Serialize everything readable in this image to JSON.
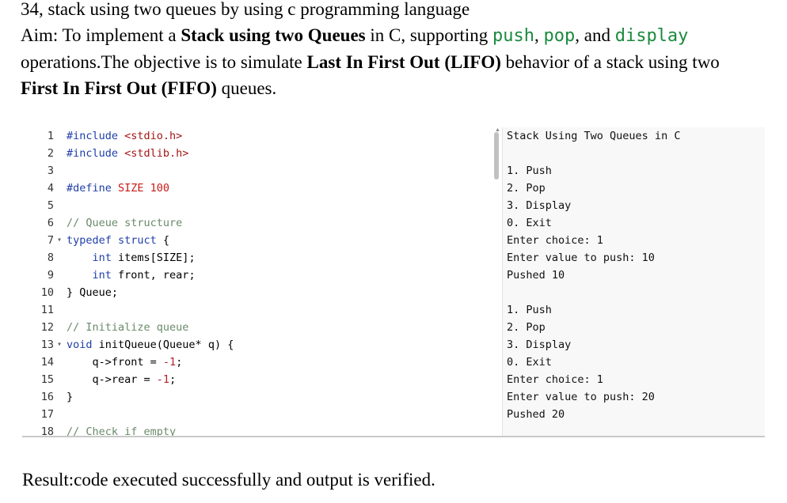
{
  "document": {
    "title": "34, stack using two queues by using c programming language",
    "aim": {
      "prefix": "Aim: To implement a ",
      "bold1": "Stack using two Queues",
      "mid1": " in C, supporting ",
      "op_push": "push",
      "sep1": ", ",
      "op_pop": "pop",
      "sep2": ", and ",
      "op_display": "display",
      "line2_start": "operations.The objective is to simulate ",
      "bold2": "Last In First Out (LIFO)",
      "line2_end": " behavior of a stack using two",
      "bold3": "First In First Out (FIFO)",
      "line3_end": " queues."
    },
    "result": "Result:code executed successfully and output is verified."
  },
  "code_lines": [
    {
      "num": "1",
      "fold": "",
      "segs": [
        {
          "c": "kw",
          "t": "#include "
        },
        {
          "c": "str",
          "t": "<stdio.h>"
        }
      ]
    },
    {
      "num": "2",
      "fold": "",
      "segs": [
        {
          "c": "kw",
          "t": "#include "
        },
        {
          "c": "str",
          "t": "<stdlib.h>"
        }
      ]
    },
    {
      "num": "3",
      "fold": "",
      "segs": []
    },
    {
      "num": "4",
      "fold": "",
      "segs": [
        {
          "c": "kw",
          "t": "#define "
        },
        {
          "c": "id",
          "t": "SIZE 100"
        }
      ]
    },
    {
      "num": "5",
      "fold": "",
      "segs": []
    },
    {
      "num": "6",
      "fold": "",
      "segs": [
        {
          "c": "cmt",
          "t": "// Queue structure"
        }
      ]
    },
    {
      "num": "7",
      "fold": "▾",
      "segs": [
        {
          "c": "kw",
          "t": "typedef struct"
        },
        {
          "c": "",
          "t": " {"
        }
      ]
    },
    {
      "num": "8",
      "fold": "",
      "segs": [
        {
          "c": "",
          "t": "    "
        },
        {
          "c": "kw",
          "t": "int"
        },
        {
          "c": "",
          "t": " items[SIZE];"
        }
      ]
    },
    {
      "num": "9",
      "fold": "",
      "segs": [
        {
          "c": "",
          "t": "    "
        },
        {
          "c": "kw",
          "t": "int"
        },
        {
          "c": "",
          "t": " front, rear;"
        }
      ]
    },
    {
      "num": "10",
      "fold": "",
      "segs": [
        {
          "c": "",
          "t": "} Queue;"
        }
      ]
    },
    {
      "num": "11",
      "fold": "",
      "segs": []
    },
    {
      "num": "12",
      "fold": "",
      "segs": [
        {
          "c": "cmt",
          "t": "// Initialize queue"
        }
      ]
    },
    {
      "num": "13",
      "fold": "▾",
      "segs": [
        {
          "c": "kw",
          "t": "void"
        },
        {
          "c": "",
          "t": " initQueue(Queue* q) {"
        }
      ]
    },
    {
      "num": "14",
      "fold": "",
      "segs": [
        {
          "c": "",
          "t": "    q->front = "
        },
        {
          "c": "num",
          "t": "-1"
        },
        {
          "c": "",
          "t": ";"
        }
      ]
    },
    {
      "num": "15",
      "fold": "",
      "segs": [
        {
          "c": "",
          "t": "    q->rear = "
        },
        {
          "c": "num",
          "t": "-1"
        },
        {
          "c": "",
          "t": ";"
        }
      ]
    },
    {
      "num": "16",
      "fold": "",
      "segs": [
        {
          "c": "",
          "t": "}"
        }
      ]
    },
    {
      "num": "17",
      "fold": "",
      "segs": []
    },
    {
      "num": "18",
      "fold": "",
      "segs": [
        {
          "c": "cmt",
          "t": "// Check if empty"
        }
      ]
    }
  ],
  "output_lines": [
    "Stack Using Two Queues in C",
    "",
    "1. Push",
    "2. Pop",
    "3. Display",
    "0. Exit",
    "Enter choice: 1",
    "Enter value to push: 10",
    "Pushed 10",
    "",
    "1. Push",
    "2. Pop",
    "3. Display",
    "0. Exit",
    "Enter choice: 1",
    "Enter value to push: 20",
    "Pushed 20"
  ],
  "colors": {
    "keyword": "#1f3ea8",
    "string": "#a31515",
    "comment": "#6a8a6a",
    "number": "#b5202a",
    "inline_code": "#1b8a3e"
  }
}
